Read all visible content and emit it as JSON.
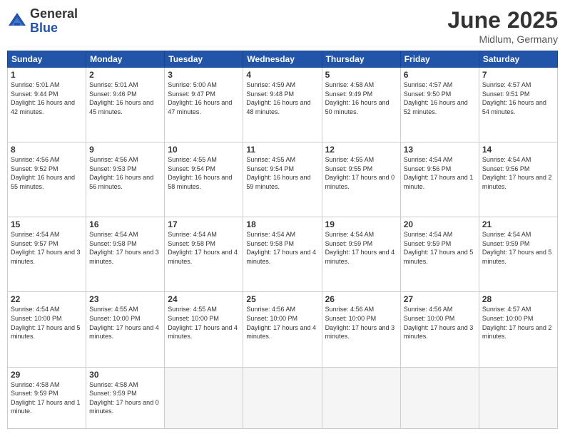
{
  "app": {
    "logo_general": "General",
    "logo_blue": "Blue"
  },
  "header": {
    "month": "June 2025",
    "location": "Midlum, Germany"
  },
  "weekdays": [
    "Sunday",
    "Monday",
    "Tuesday",
    "Wednesday",
    "Thursday",
    "Friday",
    "Saturday"
  ],
  "weeks": [
    [
      {
        "day": "1",
        "sunrise": "Sunrise: 5:01 AM",
        "sunset": "Sunset: 9:44 PM",
        "daylight": "Daylight: 16 hours and 42 minutes."
      },
      {
        "day": "2",
        "sunrise": "Sunrise: 5:01 AM",
        "sunset": "Sunset: 9:46 PM",
        "daylight": "Daylight: 16 hours and 45 minutes."
      },
      {
        "day": "3",
        "sunrise": "Sunrise: 5:00 AM",
        "sunset": "Sunset: 9:47 PM",
        "daylight": "Daylight: 16 hours and 47 minutes."
      },
      {
        "day": "4",
        "sunrise": "Sunrise: 4:59 AM",
        "sunset": "Sunset: 9:48 PM",
        "daylight": "Daylight: 16 hours and 48 minutes."
      },
      {
        "day": "5",
        "sunrise": "Sunrise: 4:58 AM",
        "sunset": "Sunset: 9:49 PM",
        "daylight": "Daylight: 16 hours and 50 minutes."
      },
      {
        "day": "6",
        "sunrise": "Sunrise: 4:57 AM",
        "sunset": "Sunset: 9:50 PM",
        "daylight": "Daylight: 16 hours and 52 minutes."
      },
      {
        "day": "7",
        "sunrise": "Sunrise: 4:57 AM",
        "sunset": "Sunset: 9:51 PM",
        "daylight": "Daylight: 16 hours and 54 minutes."
      }
    ],
    [
      {
        "day": "8",
        "sunrise": "Sunrise: 4:56 AM",
        "sunset": "Sunset: 9:52 PM",
        "daylight": "Daylight: 16 hours and 55 minutes."
      },
      {
        "day": "9",
        "sunrise": "Sunrise: 4:56 AM",
        "sunset": "Sunset: 9:53 PM",
        "daylight": "Daylight: 16 hours and 56 minutes."
      },
      {
        "day": "10",
        "sunrise": "Sunrise: 4:55 AM",
        "sunset": "Sunset: 9:54 PM",
        "daylight": "Daylight: 16 hours and 58 minutes."
      },
      {
        "day": "11",
        "sunrise": "Sunrise: 4:55 AM",
        "sunset": "Sunset: 9:54 PM",
        "daylight": "Daylight: 16 hours and 59 minutes."
      },
      {
        "day": "12",
        "sunrise": "Sunrise: 4:55 AM",
        "sunset": "Sunset: 9:55 PM",
        "daylight": "Daylight: 17 hours and 0 minutes."
      },
      {
        "day": "13",
        "sunrise": "Sunrise: 4:54 AM",
        "sunset": "Sunset: 9:56 PM",
        "daylight": "Daylight: 17 hours and 1 minute."
      },
      {
        "day": "14",
        "sunrise": "Sunrise: 4:54 AM",
        "sunset": "Sunset: 9:56 PM",
        "daylight": "Daylight: 17 hours and 2 minutes."
      }
    ],
    [
      {
        "day": "15",
        "sunrise": "Sunrise: 4:54 AM",
        "sunset": "Sunset: 9:57 PM",
        "daylight": "Daylight: 17 hours and 3 minutes."
      },
      {
        "day": "16",
        "sunrise": "Sunrise: 4:54 AM",
        "sunset": "Sunset: 9:58 PM",
        "daylight": "Daylight: 17 hours and 3 minutes."
      },
      {
        "day": "17",
        "sunrise": "Sunrise: 4:54 AM",
        "sunset": "Sunset: 9:58 PM",
        "daylight": "Daylight: 17 hours and 4 minutes."
      },
      {
        "day": "18",
        "sunrise": "Sunrise: 4:54 AM",
        "sunset": "Sunset: 9:58 PM",
        "daylight": "Daylight: 17 hours and 4 minutes."
      },
      {
        "day": "19",
        "sunrise": "Sunrise: 4:54 AM",
        "sunset": "Sunset: 9:59 PM",
        "daylight": "Daylight: 17 hours and 4 minutes."
      },
      {
        "day": "20",
        "sunrise": "Sunrise: 4:54 AM",
        "sunset": "Sunset: 9:59 PM",
        "daylight": "Daylight: 17 hours and 5 minutes."
      },
      {
        "day": "21",
        "sunrise": "Sunrise: 4:54 AM",
        "sunset": "Sunset: 9:59 PM",
        "daylight": "Daylight: 17 hours and 5 minutes."
      }
    ],
    [
      {
        "day": "22",
        "sunrise": "Sunrise: 4:54 AM",
        "sunset": "Sunset: 10:00 PM",
        "daylight": "Daylight: 17 hours and 5 minutes."
      },
      {
        "day": "23",
        "sunrise": "Sunrise: 4:55 AM",
        "sunset": "Sunset: 10:00 PM",
        "daylight": "Daylight: 17 hours and 4 minutes."
      },
      {
        "day": "24",
        "sunrise": "Sunrise: 4:55 AM",
        "sunset": "Sunset: 10:00 PM",
        "daylight": "Daylight: 17 hours and 4 minutes."
      },
      {
        "day": "25",
        "sunrise": "Sunrise: 4:56 AM",
        "sunset": "Sunset: 10:00 PM",
        "daylight": "Daylight: 17 hours and 4 minutes."
      },
      {
        "day": "26",
        "sunrise": "Sunrise: 4:56 AM",
        "sunset": "Sunset: 10:00 PM",
        "daylight": "Daylight: 17 hours and 3 minutes."
      },
      {
        "day": "27",
        "sunrise": "Sunrise: 4:56 AM",
        "sunset": "Sunset: 10:00 PM",
        "daylight": "Daylight: 17 hours and 3 minutes."
      },
      {
        "day": "28",
        "sunrise": "Sunrise: 4:57 AM",
        "sunset": "Sunset: 10:00 PM",
        "daylight": "Daylight: 17 hours and 2 minutes."
      }
    ],
    [
      {
        "day": "29",
        "sunrise": "Sunrise: 4:58 AM",
        "sunset": "Sunset: 9:59 PM",
        "daylight": "Daylight: 17 hours and 1 minute."
      },
      {
        "day": "30",
        "sunrise": "Sunrise: 4:58 AM",
        "sunset": "Sunset: 9:59 PM",
        "daylight": "Daylight: 17 hours and 0 minutes."
      },
      null,
      null,
      null,
      null,
      null
    ]
  ]
}
